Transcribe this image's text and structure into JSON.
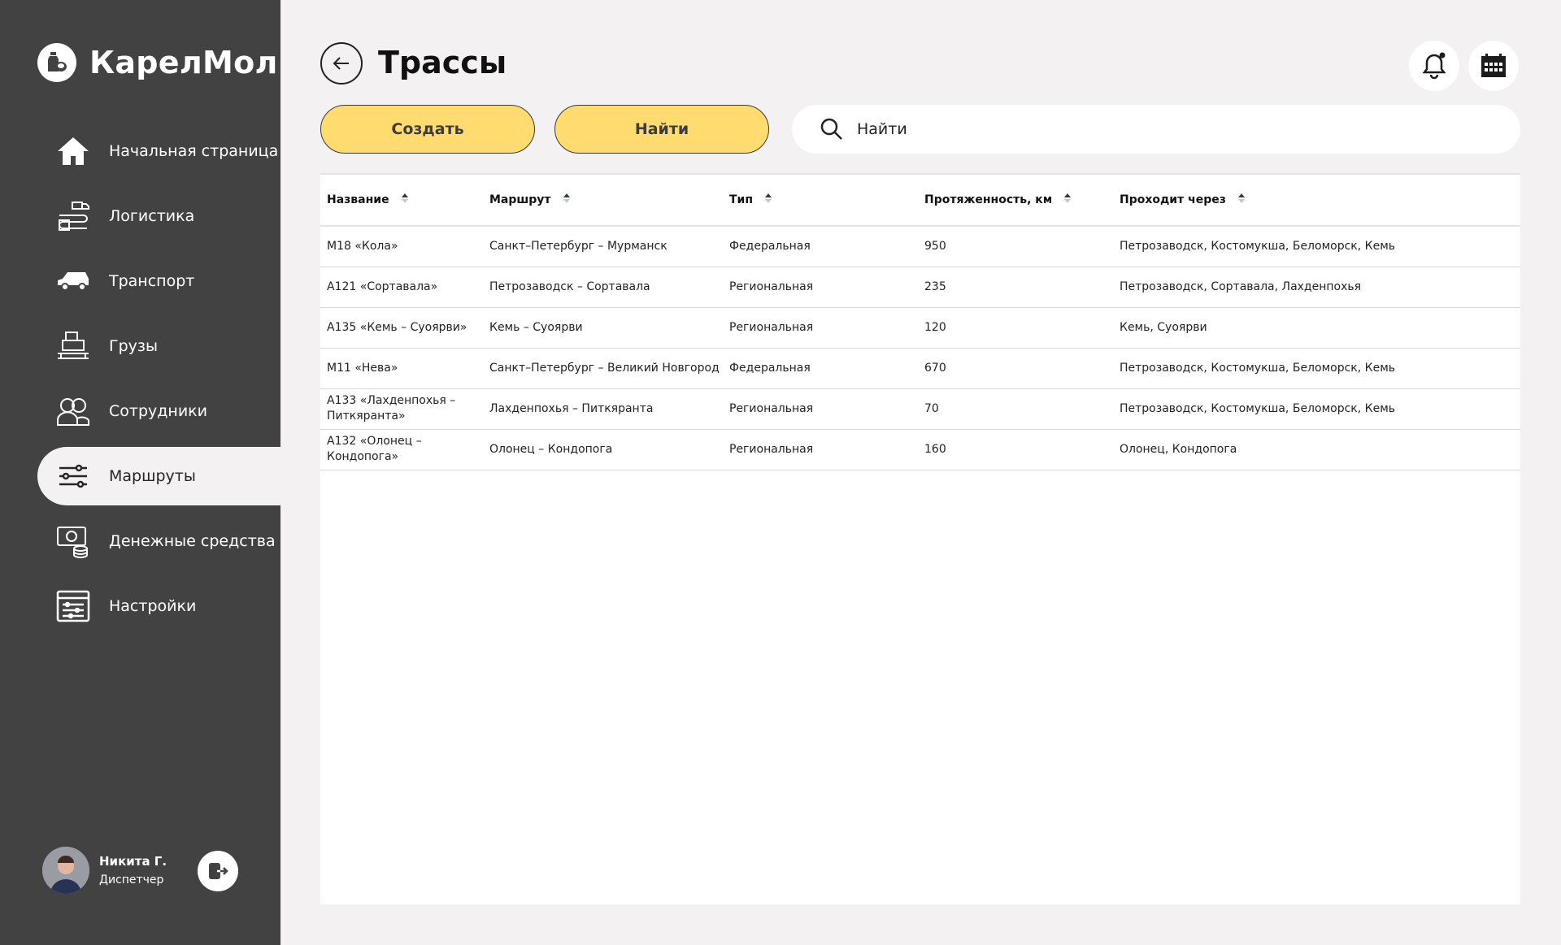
{
  "app": {
    "name": "КарелМол"
  },
  "sidebar": {
    "items": [
      {
        "label": "Начальная страница",
        "icon": "home-icon",
        "active": false
      },
      {
        "label": "Логистика",
        "icon": "logistics-icon",
        "active": false
      },
      {
        "label": "Транспорт",
        "icon": "truck-icon",
        "active": false
      },
      {
        "label": "Грузы",
        "icon": "cargo-icon",
        "active": false
      },
      {
        "label": "Сотрудники",
        "icon": "employees-icon",
        "active": false
      },
      {
        "label": "Маршруты",
        "icon": "routes-icon",
        "active": true
      },
      {
        "label": "Денежные средства",
        "icon": "money-icon",
        "active": false
      },
      {
        "label": "Настройки",
        "icon": "settings-icon",
        "active": false
      }
    ]
  },
  "user": {
    "name": "Никита Г.",
    "role": "Диспетчер"
  },
  "page": {
    "title": "Трассы"
  },
  "toolbar": {
    "create_label": "Создать",
    "find_label": "Найти"
  },
  "search": {
    "placeholder": "Найти"
  },
  "table": {
    "columns": [
      "Название",
      "Маршрут",
      "Тип",
      "Протяженность, км",
      "Проходит через"
    ],
    "rows": [
      [
        "М18 «Кола»",
        "Санкт–Петербург – Мурманск",
        "Федеральная",
        "950",
        "Петрозаводск, Костомукша, Беломорск, Кемь"
      ],
      [
        "А121 «Сортавала»",
        "Петрозаводск – Сортавала",
        "Региональная",
        "235",
        "Петрозаводск, Сортавала, Лахденпохья"
      ],
      [
        "А135 «Кемь – Суоярви»",
        "Кемь – Суоярви",
        "Региональная",
        "120",
        "Кемь, Суоярви"
      ],
      [
        "М11 «Нева»",
        "Санкт–Петербург – Великий Новгород",
        "Федеральная",
        "670",
        "Петрозаводск, Костомукша, Беломорск, Кемь"
      ],
      [
        "А133 «Лахденпохья – Питкяранта»",
        "Лахденпохья – Питкяранта",
        "Региональная",
        "70",
        "Петрозаводск, Костомукша, Беломорск, Кемь"
      ],
      [
        "А132 «Олонец – Кондопога»",
        "Олонец – Кондопога",
        "Региональная",
        "160",
        "Олонец, Кондопога"
      ]
    ]
  },
  "colors": {
    "sidebar_bg": "#424242",
    "accent_yellow": "#ffdb70",
    "page_bg": "#f3f1f2"
  }
}
